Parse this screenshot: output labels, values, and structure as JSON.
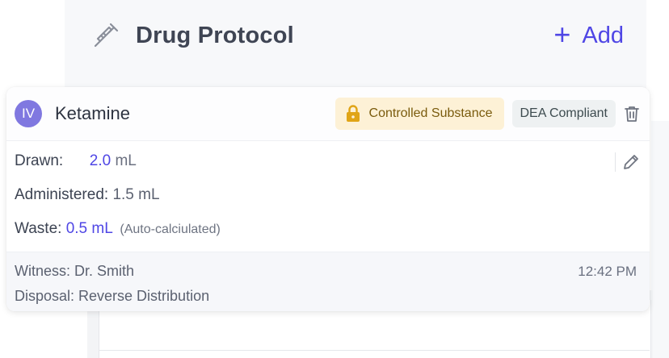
{
  "header": {
    "title": "Drug Protocol",
    "add_label": "Add",
    "add_symbol": "+"
  },
  "drug": {
    "route_badge": "IV",
    "name": "Ketamine",
    "badges": {
      "controlled": "Controlled Substance",
      "dea": "DEA Compliant"
    },
    "drawn_label": "Drawn:",
    "drawn_value": "2.0",
    "drawn_unit": "mL",
    "administered_label": "Administered:",
    "administered_value": "1.5 mL",
    "waste_label": "Waste:",
    "waste_value": "0.5 mL",
    "waste_note": "(Auto-calciulated)"
  },
  "footer": {
    "witness": "Witness: Dr. Smith",
    "disposal": "Disposal: Reverse Distribution",
    "time": "12:42 PM"
  },
  "colors": {
    "accent": "#4f46e5",
    "route_badge": "#8078e0",
    "controlled_bg": "#fdf1d6",
    "controlled_text": "#7a5b0d",
    "dea_bg": "#eef1f2"
  },
  "icons": {
    "header": "syringe-icon",
    "controlled": "lock-icon",
    "delete": "trash-icon",
    "edit": "pencil-icon"
  }
}
